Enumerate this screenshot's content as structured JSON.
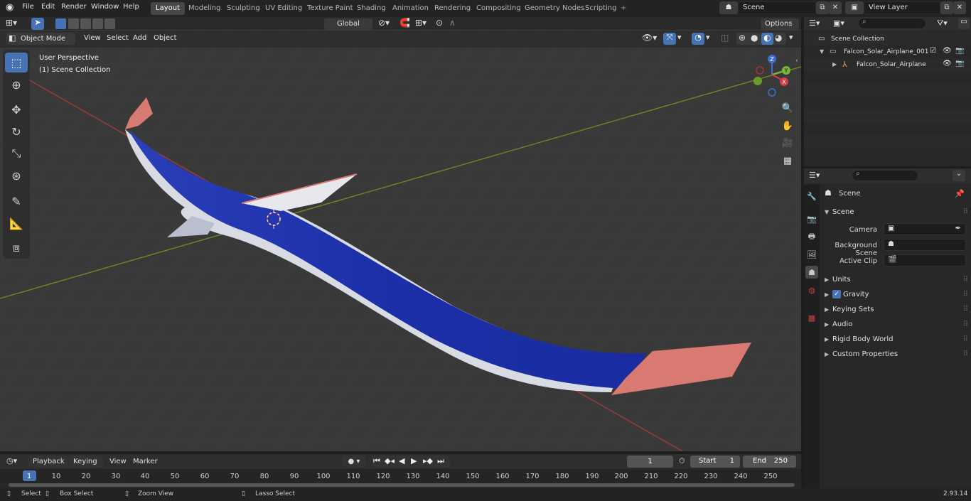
{
  "topbar": {
    "menus": [
      "File",
      "Edit",
      "Render",
      "Window",
      "Help"
    ],
    "workspaces": [
      "Layout",
      "Modeling",
      "Sculpting",
      "UV Editing",
      "Texture Paint",
      "Shading",
      "Animation",
      "Rendering",
      "Compositing",
      "Geometry Nodes",
      "Scripting"
    ],
    "active_workspace": "Layout",
    "add_tab": "+",
    "scene_name": "Scene",
    "view_layer": "View Layer"
  },
  "viewport_header": {
    "mode": "Object Mode",
    "menus": [
      "View",
      "Select",
      "Add",
      "Object"
    ],
    "transform_orientation": "Global",
    "options": "Options"
  },
  "viewport": {
    "perspective_label": "User Perspective",
    "collection_label": "(1) Scene Collection",
    "gizmo_axes": {
      "z": "Z",
      "y": "Y",
      "x": "X"
    }
  },
  "outliner": {
    "search_placeholder": "",
    "root": "Scene Collection",
    "collection": "Falcon_Solar_Airplane_001",
    "object": "Falcon_Solar_Airplane"
  },
  "properties": {
    "search_placeholder": "",
    "context": "Scene",
    "panel_title": "Scene",
    "fields": [
      {
        "label": "Camera"
      },
      {
        "label": "Background Scene"
      },
      {
        "label": "Active Clip"
      }
    ],
    "panels": [
      "Units",
      "Gravity",
      "Keying Sets",
      "Audio",
      "Rigid Body World",
      "Custom Properties"
    ],
    "gravity_checked": true
  },
  "timeline": {
    "menus": [
      "Playback",
      "Keying",
      "View",
      "Marker"
    ],
    "current_frame": "1",
    "start_label": "Start",
    "start_value": "1",
    "end_label": "End",
    "end_value": "250",
    "ruler": [
      "1",
      "10",
      "20",
      "30",
      "40",
      "50",
      "60",
      "70",
      "80",
      "90",
      "100",
      "110",
      "120",
      "130",
      "140",
      "150",
      "160",
      "170",
      "180",
      "190",
      "200",
      "210",
      "220",
      "230",
      "240",
      "250"
    ]
  },
  "statusbar": {
    "items": [
      "Select",
      "Box Select",
      "Zoom View",
      "Lasso Select"
    ],
    "version": "2.93.14"
  },
  "colors": {
    "accent": "#4772b3",
    "wing_blue": "#1b2fa8",
    "wing_tip": "#d97a72",
    "axis_x": "#a23a3a",
    "axis_y": "#6a8a2a"
  }
}
